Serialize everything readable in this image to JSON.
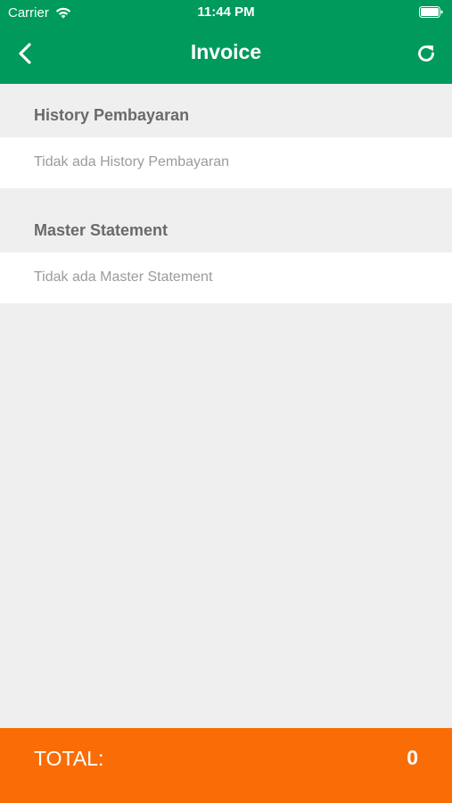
{
  "status_bar": {
    "carrier": "Carrier",
    "time": "11:44 PM",
    "wifi_icon": "wifi-icon",
    "battery_icon": "battery-icon"
  },
  "nav": {
    "title": "Invoice",
    "back_icon": "chevron-left-icon",
    "refresh_icon": "refresh-icon"
  },
  "sections": [
    {
      "title": "History Pembayaran",
      "empty_text": "Tidak ada History Pembayaran"
    },
    {
      "title": "Master Statement",
      "empty_text": "Tidak ada Master Statement"
    }
  ],
  "footer": {
    "total_label": "TOTAL:",
    "total_value": "0"
  },
  "colors": {
    "header_green": "#009a5c",
    "footer_orange": "#fa6d06",
    "background_gray": "#efefef",
    "section_title_gray": "#6a6a6a",
    "row_text_gray": "#9b9b9b"
  }
}
